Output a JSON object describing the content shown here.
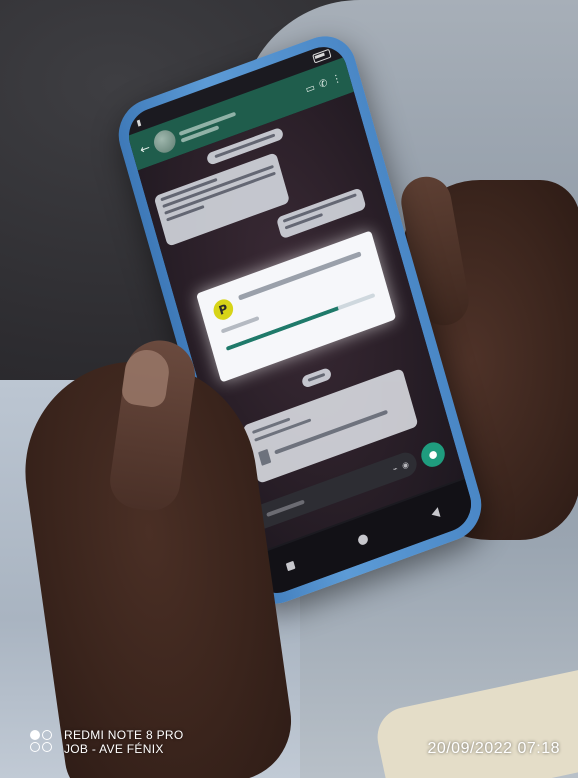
{
  "watermark": {
    "device_model": "REDMI NOTE 8 PRO",
    "caption": "JOB - AVE FÉNIX",
    "datetime": "20/09/2022 07:18",
    "icon": "dual-camera-icon"
  },
  "phone": {
    "app": "WhatsApp",
    "dialog": {
      "icon_letter": "P",
      "progress": 0.75
    }
  },
  "colors": {
    "case": "#4a87c6",
    "whatsapp_header": "#1f5d4c",
    "dialog_icon": "#d7d418",
    "progress": "#1f7a6a"
  }
}
